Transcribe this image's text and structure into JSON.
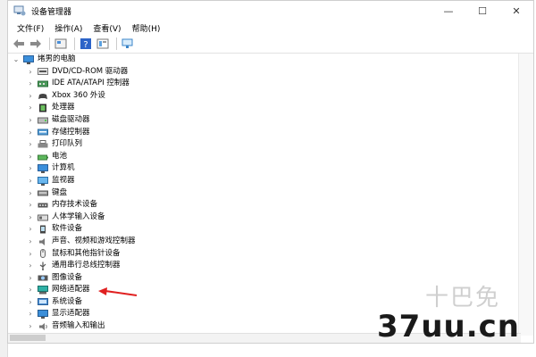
{
  "window": {
    "title": "设备管理器",
    "controls": {
      "minimize": "—",
      "maximize": "☐",
      "close": "✕"
    }
  },
  "menubar": [
    {
      "label": "文件(F)"
    },
    {
      "label": "操作(A)"
    },
    {
      "label": "查看(V)"
    },
    {
      "label": "帮助(H)"
    }
  ],
  "tree": {
    "root": "堵男的电脑",
    "items": [
      {
        "label": "DVD/CD-ROM 驱动器",
        "icon": "dvd-icon"
      },
      {
        "label": "IDE ATA/ATAPI 控制器",
        "icon": "ide-controller-icon"
      },
      {
        "label": "Xbox 360 外设",
        "icon": "gamepad-icon"
      },
      {
        "label": "处理器",
        "icon": "processor-icon"
      },
      {
        "label": "磁盘驱动器",
        "icon": "disk-drive-icon"
      },
      {
        "label": "存储控制器",
        "icon": "storage-controller-icon"
      },
      {
        "label": "打印队列",
        "icon": "printer-icon"
      },
      {
        "label": "电池",
        "icon": "battery-icon"
      },
      {
        "label": "计算机",
        "icon": "computer-icon"
      },
      {
        "label": "监视器",
        "icon": "monitor-icon"
      },
      {
        "label": "键盘",
        "icon": "keyboard-icon"
      },
      {
        "label": "内存技术设备",
        "icon": "memory-device-icon"
      },
      {
        "label": "人体学输入设备",
        "icon": "hid-icon"
      },
      {
        "label": "软件设备",
        "icon": "software-device-icon"
      },
      {
        "label": "声音、视频和游戏控制器",
        "icon": "speaker-icon"
      },
      {
        "label": "鼠标和其他指针设备",
        "icon": "mouse-icon"
      },
      {
        "label": "通用串行总线控制器",
        "icon": "usb-icon"
      },
      {
        "label": "图像设备",
        "icon": "camera-icon"
      },
      {
        "label": "网络适配器",
        "icon": "network-adapter-icon"
      },
      {
        "label": "系统设备",
        "icon": "system-device-icon"
      },
      {
        "label": "显示适配器",
        "icon": "display-adapter-icon"
      },
      {
        "label": "音频输入和输出",
        "icon": "audio-io-icon"
      }
    ]
  },
  "watermark": {
    "text": "37uu.cn",
    "cn": "十巴免"
  },
  "colors": {
    "arrow": "#e02020",
    "icon_blue": "#2f7fd0",
    "icon_gray": "#7a7a7a"
  }
}
